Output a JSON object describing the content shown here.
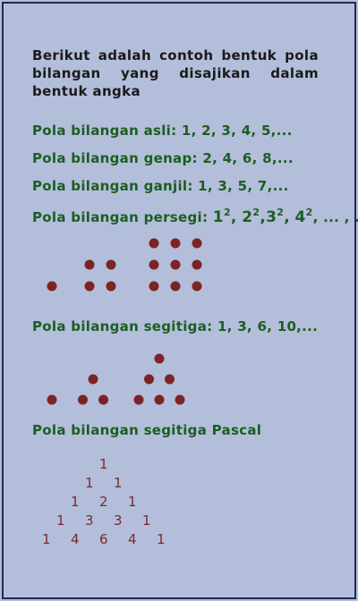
{
  "intro": "Berikut adalah contoh bentuk pola bilangan yang disajikan dalam bentuk angka",
  "lines": {
    "asli": "Pola bilangan asli: 1, 2, 3, 4, 5,...",
    "genap": "Pola bilangan genap: 2, 4, 6, 8,...",
    "ganjil": "Pola bilangan ganjil: 1, 3, 5, 7,...",
    "persegi_label": "Pola bilangan persegi:",
    "persegi_tail": ", ... , ...",
    "segitiga": "Pola bilangan segitiga: 1, 3, 6, 10,...",
    "pascal_title": "Pola bilangan segitiga Pascal"
  },
  "squares": [
    {
      "base": "1",
      "exp": "2"
    },
    {
      "base": "2",
      "exp": "2"
    },
    {
      "base": "3",
      "exp": "2"
    },
    {
      "base": "4",
      "exp": "2"
    }
  ],
  "dot_color": "#7b2424",
  "text_green": "#1b5e20",
  "pascal_rows": [
    [
      "1"
    ],
    [
      "1",
      "1"
    ],
    [
      "1",
      "2",
      "1"
    ],
    [
      "1",
      "3",
      "3",
      "1"
    ],
    [
      "1",
      "4",
      "6",
      "4",
      "1"
    ]
  ]
}
